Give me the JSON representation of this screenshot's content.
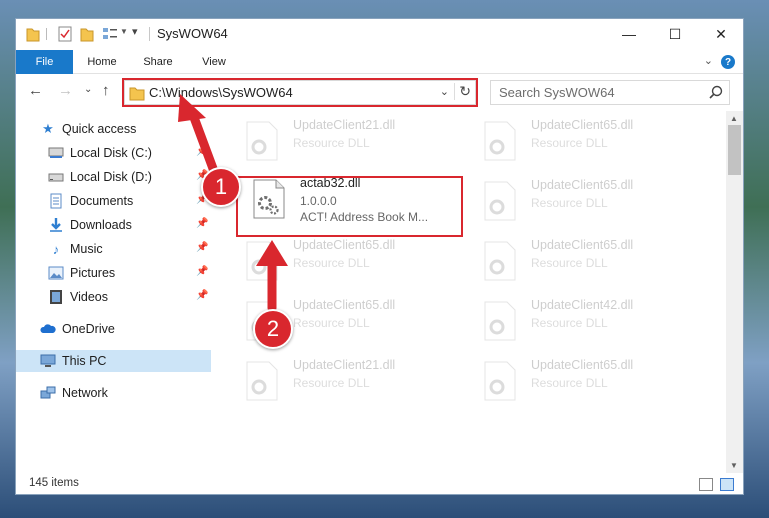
{
  "window": {
    "title": "SysWOW64"
  },
  "ribbon": {
    "tabs": [
      "File",
      "Home",
      "Share",
      "View"
    ]
  },
  "address": {
    "path": "C:\\Windows\\SysWOW64"
  },
  "search": {
    "placeholder": "Search SysWOW64"
  },
  "sidebar": {
    "items": [
      {
        "label": "Quick access",
        "icon": "star-icon"
      },
      {
        "label": "Local Disk (C:)",
        "icon": "drive-icon"
      },
      {
        "label": "Local Disk (D:)",
        "icon": "drive-icon"
      },
      {
        "label": "Documents",
        "icon": "documents-icon"
      },
      {
        "label": "Downloads",
        "icon": "download-icon"
      },
      {
        "label": "Music",
        "icon": "music-icon"
      },
      {
        "label": "Pictures",
        "icon": "pictures-icon"
      },
      {
        "label": "Videos",
        "icon": "videos-icon"
      },
      {
        "label": "OneDrive",
        "icon": "cloud-icon"
      },
      {
        "label": "This PC",
        "icon": "computer-icon"
      },
      {
        "label": "Network",
        "icon": "network-icon"
      }
    ]
  },
  "files": [
    {
      "name": "UpdateClient21.dll",
      "line2": "Resource DLL",
      "line3": ""
    },
    {
      "name": "UpdateClient65.dll",
      "line2": "Resource DLL",
      "line3": ""
    },
    {
      "name": "actab32.dll",
      "line2": "1.0.0.0",
      "line3": "ACT! Address Book M..."
    },
    {
      "name": "UpdateClient65.dll",
      "line2": "Resource DLL",
      "line3": ""
    },
    {
      "name": "UpdateClient65.dll",
      "line2": "Resource DLL",
      "line3": ""
    },
    {
      "name": "UpdateClient65.dll",
      "line2": "Resource DLL",
      "line3": ""
    },
    {
      "name": "UpdateClient65.dll",
      "line2": "Resource DLL",
      "line3": ""
    },
    {
      "name": "UpdateClient42.dll",
      "line2": "Resource DLL",
      "line3": ""
    },
    {
      "name": "UpdateClient21.dll",
      "line2": "Resource DLL",
      "line3": ""
    },
    {
      "name": "UpdateClient65.dll",
      "line2": "Resource DLL",
      "line3": ""
    }
  ],
  "status": {
    "item_count": "145 items"
  },
  "callouts": [
    "1",
    "2"
  ],
  "colors": {
    "accent": "#1979ca",
    "callout": "#d9272e",
    "selection": "#cce4f7"
  }
}
